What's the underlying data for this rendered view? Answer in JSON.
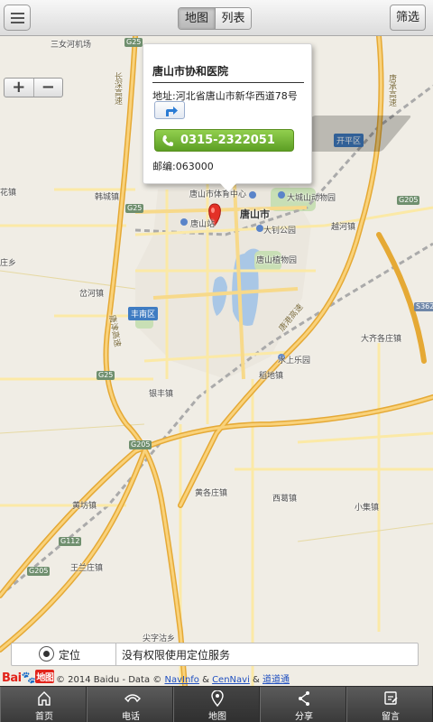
{
  "header": {
    "tabs": [
      {
        "label": "地图",
        "active": true
      },
      {
        "label": "列表",
        "active": false
      }
    ],
    "filter_label": "筛选"
  },
  "map": {
    "zoom_in": "+",
    "zoom_out": "−",
    "labels": {
      "sannvhe": "三女河机场",
      "hancheng": "韩城镇",
      "tangshan_city": "唐山市",
      "tangshan_station": "唐山站",
      "dachengshan": "大城山动物园",
      "dazhao": "大钊公园",
      "yuehe": "越河镇",
      "kaiping": "开平区",
      "botanical": "唐山植物园",
      "fengnan": "丰南区",
      "daqiangezhuang": "大齐各庄镇",
      "shuishang": "水上乐园",
      "daodi": "稻地镇",
      "yinfeng": "银丰镇",
      "huanggezhuang": "黄各庄镇",
      "xige": "西葛镇",
      "xiaoji": "小集镇",
      "huangfang": "黄坊镇",
      "wanglanzhuang": "王兰庄镇",
      "jianzi": "尖字沽乡",
      "chaojian": "岔河镇",
      "zhuangxiang": "庄乡",
      "huazhen": "花镇",
      "tangshan_popup_area": "唐山市体育中心",
      "changshen_hw": "长深高速",
      "tangjin_hw": "唐津高速",
      "tanggang_hw": "唐港高速",
      "tangcheng_hw": "唐承高速"
    },
    "road_shields": [
      "G25",
      "G25",
      "G25",
      "G205",
      "G205",
      "G205",
      "G112",
      "S362"
    ]
  },
  "popup": {
    "title": "唐山市协和医院",
    "address": "地址:河北省唐山市新华西道78号",
    "phone": "0315-2322051",
    "zip": "邮编:063000"
  },
  "locate": {
    "button_label": "定位",
    "message": "没有权限使用定位服务"
  },
  "attribution": {
    "logo_left": "Bai",
    "logo_right": "地图",
    "text": "© 2014 Baidu - Data © ",
    "link1": "NavInfo",
    "sep": " & ",
    "link2": "CenNavi",
    "sep2": " & ",
    "link3": "道道通"
  },
  "bottom_nav": [
    {
      "label": "首页",
      "icon": "home-icon"
    },
    {
      "label": "电话",
      "icon": "phone-icon"
    },
    {
      "label": "地图",
      "icon": "map-pin-icon",
      "active": true
    },
    {
      "label": "分享",
      "icon": "share-icon"
    },
    {
      "label": "留言",
      "icon": "message-icon"
    }
  ],
  "colors": {
    "highway": "#f5c04a",
    "road": "#fbe9a6",
    "water": "#a9c7e6",
    "park": "#c8dfb5",
    "call_button": "#6bab2e",
    "marker": "#e33027"
  }
}
